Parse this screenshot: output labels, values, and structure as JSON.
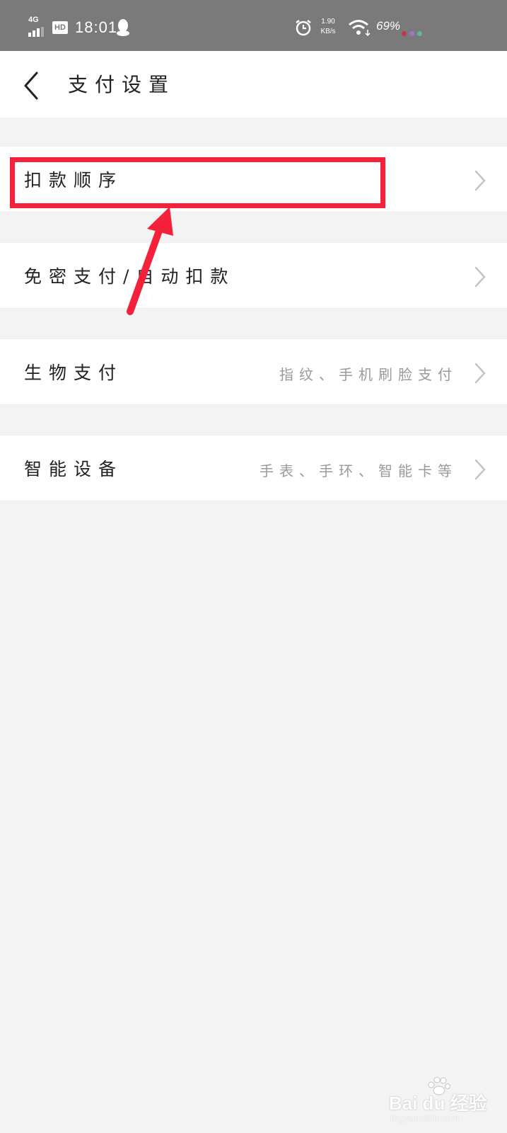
{
  "status_bar": {
    "network": "4G",
    "hd": "HD",
    "time": "18:01",
    "speed_value": "1.90",
    "speed_unit": "KB/s",
    "battery": "69%",
    "dot_colors": [
      "#c8344a",
      "#9a78c9",
      "#5fb6a3"
    ]
  },
  "header": {
    "title": "支付设置"
  },
  "settings": [
    {
      "label": "扣款顺序",
      "sub": ""
    },
    {
      "label": "免密支付/自动扣款",
      "sub": ""
    },
    {
      "label": "生物支付",
      "sub": "指纹、手机刷脸支付"
    },
    {
      "label": "智能设备",
      "sub": "手表、手环、智能卡等"
    }
  ],
  "annotation": {
    "color": "#f5213b"
  },
  "watermark": {
    "text": "Bai du 经验",
    "url": "jingyan.baidu.com"
  }
}
